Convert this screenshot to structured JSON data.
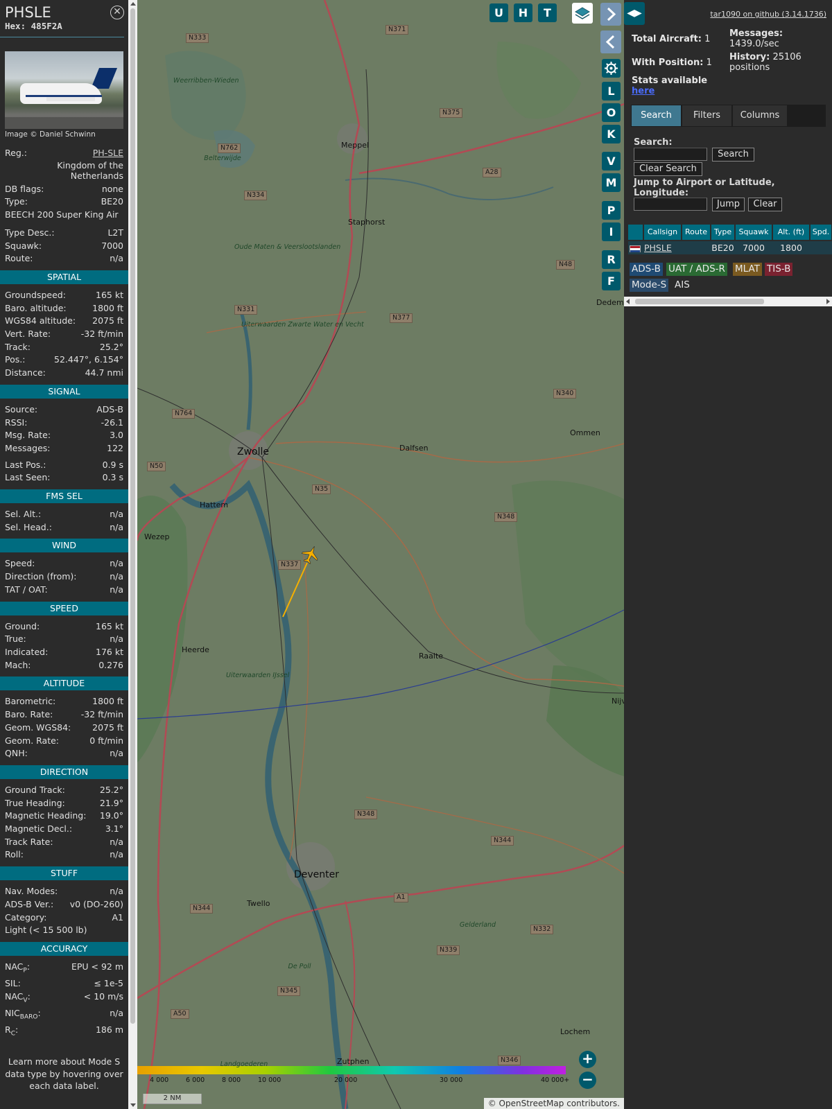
{
  "aircraft": {
    "callsign": "PHSLE",
    "hex_label": "Hex:",
    "hex": "485F2A",
    "photo_credit": "Image © Daniel Schwinn",
    "reg_label": "Reg.:",
    "reg": "PH-SLE",
    "country_line1": "Kingdom of the",
    "country_line2": "Netherlands",
    "dbflags_label": "DB flags:",
    "dbflags": "none",
    "type_label": "Type:",
    "type": "BE20",
    "model": "BEECH 200 Super King Air",
    "typedesc_label": "Type Desc.:",
    "typedesc": "L2T",
    "squawk_label": "Squawk:",
    "squawk": "7000",
    "route_label": "Route:",
    "route": "n/a"
  },
  "spatial": {
    "title": "SPATIAL",
    "rows": [
      {
        "k": "Groundspeed:",
        "v": "165 kt"
      },
      {
        "k": "Baro. altitude:",
        "v": "1800 ft"
      },
      {
        "k": "WGS84 altitude:",
        "v": "2075 ft"
      },
      {
        "k": "Vert. Rate:",
        "v": "-32 ft/min"
      },
      {
        "k": "Track:",
        "v": "25.2°"
      },
      {
        "k": "Pos.:",
        "v": "52.447°, 6.154°"
      },
      {
        "k": "Distance:",
        "v": "44.7 nmi"
      }
    ]
  },
  "signal": {
    "title": "SIGNAL",
    "rows": [
      {
        "k": "Source:",
        "v": "ADS-B"
      },
      {
        "k": "RSSI:",
        "v": "-26.1"
      },
      {
        "k": "Msg. Rate:",
        "v": "3.0"
      },
      {
        "k": "Messages:",
        "v": "122"
      }
    ],
    "rows2": [
      {
        "k": "Last Pos.:",
        "v": "0.9 s"
      },
      {
        "k": "Last Seen:",
        "v": "0.3 s"
      }
    ]
  },
  "fmssel": {
    "title": "FMS SEL",
    "rows": [
      {
        "k": "Sel. Alt.:",
        "v": "n/a"
      },
      {
        "k": "Sel. Head.:",
        "v": "n/a"
      }
    ]
  },
  "wind": {
    "title": "WIND",
    "rows": [
      {
        "k": "Speed:",
        "v": "n/a"
      },
      {
        "k": "Direction (from):",
        "v": "n/a"
      },
      {
        "k": "TAT / OAT:",
        "v": "n/a"
      }
    ]
  },
  "speed": {
    "title": "SPEED",
    "rows": [
      {
        "k": "Ground:",
        "v": "165 kt"
      },
      {
        "k": "True:",
        "v": "n/a"
      },
      {
        "k": "Indicated:",
        "v": "176 kt"
      },
      {
        "k": "Mach:",
        "v": "0.276"
      }
    ]
  },
  "altitude": {
    "title": "ALTITUDE",
    "rows": [
      {
        "k": "Barometric:",
        "v": "1800 ft"
      },
      {
        "k": "Baro. Rate:",
        "v": "-32 ft/min"
      },
      {
        "k": "Geom. WGS84:",
        "v": "2075 ft"
      },
      {
        "k": "Geom. Rate:",
        "v": "0 ft/min"
      },
      {
        "k": "QNH:",
        "v": "n/a"
      }
    ]
  },
  "direction": {
    "title": "DIRECTION",
    "rows": [
      {
        "k": "Ground Track:",
        "v": "25.2°"
      },
      {
        "k": "True Heading:",
        "v": "21.9°"
      },
      {
        "k": "Magnetic Heading:",
        "v": "19.0°"
      },
      {
        "k": "Magnetic Decl.:",
        "v": "3.1°"
      },
      {
        "k": "Track Rate:",
        "v": "n/a"
      },
      {
        "k": "Roll:",
        "v": "n/a"
      }
    ]
  },
  "stuff": {
    "title": "STUFF",
    "rows": [
      {
        "k": "Nav. Modes:",
        "v": "n/a"
      },
      {
        "k": "ADS-B Ver.:",
        "v": "v0 (DO-260)"
      },
      {
        "k": "Category:",
        "v": "A1"
      }
    ],
    "category_desc": "Light (< 15 500 lb)"
  },
  "accuracy": {
    "title": "ACCURACY",
    "rows": [
      {
        "k": "NAC",
        "sub": "P",
        "v": "EPU < 92 m"
      },
      {
        "k": "SIL:",
        "sub": "",
        "v": "≤ 1e-5"
      },
      {
        "k": "NAC",
        "sub": "V",
        "v": "< 10 m/s"
      },
      {
        "k": "NIC",
        "sub": "BARO",
        "v": "n/a"
      },
      {
        "k": "R",
        "sub": "C",
        "v": "186 m"
      }
    ]
  },
  "footer_text": "Learn more about Mode S data type by hovering over each data label.",
  "map": {
    "buttons_top": [
      "U",
      "H",
      "T"
    ],
    "buttons_side": [
      "L",
      "O",
      "K",
      "V",
      "M",
      "P",
      "I",
      "R",
      "F"
    ],
    "scale_label": "2 NM",
    "altitude_legend": [
      "4 000",
      "6 000",
      "8 000",
      "10 000",
      "20 000",
      "30 000",
      "40 000+"
    ],
    "attribution_prefix": "© ",
    "attribution_link": "OpenStreetMap",
    "attribution_suffix": " contributors.",
    "place_labels": [
      "Zwolle",
      "Deventer",
      "Dalfsen",
      "Raalte",
      "Meppel",
      "Staphorst",
      "Hattem",
      "Wezep",
      "Heerde",
      "Twello",
      "Zutphen",
      "Ommen",
      "Lochem",
      "Dedems",
      "Nijv"
    ],
    "road_labels": [
      "N333",
      "N371",
      "N375",
      "N762",
      "N334",
      "A28",
      "N331",
      "N377",
      "N764",
      "N50",
      "N35",
      "N340",
      "N348",
      "N337",
      "N348",
      "N344",
      "A1",
      "N344",
      "N332",
      "N339",
      "N345",
      "A50",
      "N346",
      "N48"
    ],
    "nature_labels": [
      "Weerribben-Wieden",
      "Oude Maten & Veerslootslanden",
      "Uiterwaarden Zwarte Water en Vecht",
      "Uiterwaarden IJssel",
      "Gelderland",
      "De Poll",
      "Landgoederen",
      "Belterwijde"
    ],
    "colors": {
      "track": "#f6b000",
      "aircraft": "#f6b000",
      "arc": "#2a3d90"
    }
  },
  "sidebar": {
    "github_link": "tar1090 on github (3.14.1736)",
    "total_aircraft_label": "Total Aircraft:",
    "total_aircraft": "1",
    "with_position_label": "With Position:",
    "with_position": "1",
    "messages_label": "Messages:",
    "messages_rate": "1439.0/sec",
    "history_label": "History:",
    "history_value": "25106",
    "history_unit": "positions",
    "stats_label": "Stats available",
    "stats_link": "here",
    "tabs": [
      "Search",
      "Filters",
      "Columns"
    ],
    "search_label": "Search:",
    "search_value": "",
    "search_button": "Search",
    "clear_search_button": "Clear Search",
    "jump_label": "Jump to Airport or Latitude, Longitude:",
    "jump_value": "",
    "jump_button": "Jump",
    "clear_button": "Clear",
    "table_headers": [
      "",
      "Callsign",
      "Route",
      "Type",
      "Squawk",
      "Alt. (ft)",
      "Spd."
    ],
    "table_rows": [
      {
        "callsign": "PHSLE",
        "route": "",
        "type": "BE20",
        "squawk": "7000",
        "alt": "1800",
        "spd": ""
      }
    ],
    "sources": [
      {
        "label": "ADS-B",
        "bg": "#1f4a73",
        "fg": "#e8e8e8"
      },
      {
        "label": "UAT / ADS-R",
        "bg": "#2a6a33",
        "fg": "#e8e8e8"
      },
      {
        "label": "MLAT",
        "bg": "#7a5a20",
        "fg": "#e8e8e8"
      },
      {
        "label": "TIS-B",
        "bg": "#7a2230",
        "fg": "#e8e8e8"
      },
      {
        "label": "Mode-S",
        "bg": "#2a4a6a",
        "fg": "#e8e8e8"
      },
      {
        "label": "AIS",
        "bg": "#2b2b2b",
        "fg": "#e8e8e8"
      }
    ]
  }
}
